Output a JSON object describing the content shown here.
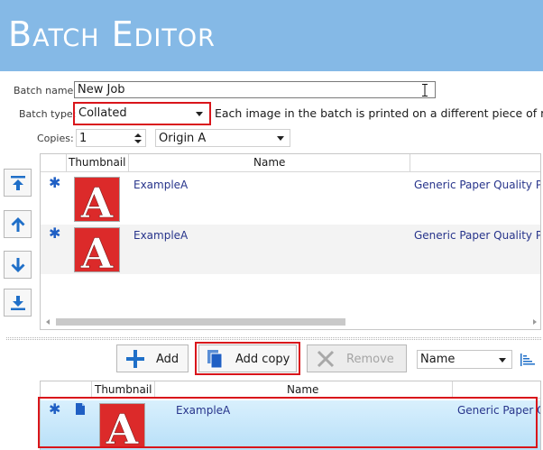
{
  "window": {
    "title": "Batch Editor"
  },
  "form": {
    "batch_name_label": "Batch name:",
    "batch_name_value": "New Job",
    "batch_type_label": "Batch type:",
    "batch_type_value": "Collated",
    "batch_type_desc": "Each image in the batch is printed on a different piece of med",
    "copies_label": "Copies:",
    "copies_value": "1",
    "origin_value": "Origin A"
  },
  "top_grid": {
    "columns": [
      "Thumbnail",
      "Name"
    ],
    "rows": [
      {
        "name": "ExampleA",
        "media": "Generic Paper Quality P"
      },
      {
        "name": "ExampleA",
        "media": "Generic Paper Quality P"
      }
    ]
  },
  "toolbar": {
    "add_label": "Add",
    "add_copy_label": "Add copy",
    "remove_label": "Remove",
    "sort_value": "Name"
  },
  "bottom_grid": {
    "columns": [
      "Thumbnail",
      "Name"
    ],
    "rows": [
      {
        "name": "ExampleA",
        "media": "Generic Paper Q"
      }
    ]
  },
  "colors": {
    "titlebar": "#85b9e6",
    "highlight": "#d9151b",
    "selected_row": "#bfe3fa",
    "icon_blue": "#1f6fc8",
    "thumbnail_red": "#dc2a2a"
  },
  "icons": [
    "move-top-icon",
    "move-up-icon",
    "move-down-icon",
    "move-bottom-icon",
    "plus-icon",
    "copy-icon",
    "x-icon",
    "sort-icon",
    "new-item-icon",
    "document-icon",
    "text-cursor-icon",
    "chevron-down-icon"
  ]
}
